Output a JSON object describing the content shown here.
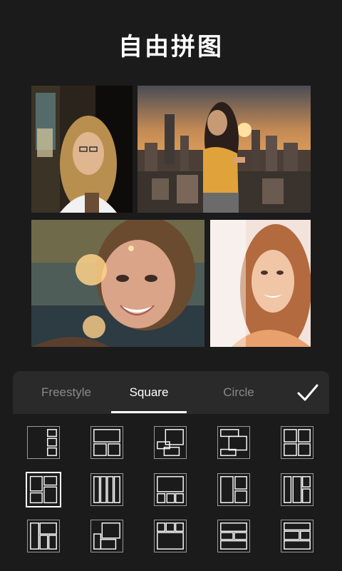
{
  "header": {
    "title": "自由拼图"
  },
  "tabs": [
    {
      "label": "Freestyle",
      "active": false
    },
    {
      "label": "Square",
      "active": true
    },
    {
      "label": "Circle",
      "active": false
    }
  ],
  "confirm_icon": "checkmark-icon",
  "photos": [
    {
      "name": "photo-woman-glasses-window"
    },
    {
      "name": "photo-woman-city-sunset"
    },
    {
      "name": "photo-woman-smiling-bokeh"
    },
    {
      "name": "photo-girl-bright-light"
    }
  ],
  "layout_templates": [
    {
      "name": "layout-1",
      "selected": false
    },
    {
      "name": "layout-2",
      "selected": false
    },
    {
      "name": "layout-3",
      "selected": false
    },
    {
      "name": "layout-4",
      "selected": false
    },
    {
      "name": "layout-5",
      "selected": false
    },
    {
      "name": "layout-6",
      "selected": true
    },
    {
      "name": "layout-7",
      "selected": false
    },
    {
      "name": "layout-8",
      "selected": false
    },
    {
      "name": "layout-9",
      "selected": false
    },
    {
      "name": "layout-10",
      "selected": false
    },
    {
      "name": "layout-11",
      "selected": false
    },
    {
      "name": "layout-12",
      "selected": false
    },
    {
      "name": "layout-13",
      "selected": false
    },
    {
      "name": "layout-14",
      "selected": false
    },
    {
      "name": "layout-15",
      "selected": false
    }
  ],
  "colors": {
    "background": "#1b1b1b",
    "panel": "#2a2a2a",
    "active_text": "#ffffff",
    "inactive_text": "#8a8a8a"
  }
}
